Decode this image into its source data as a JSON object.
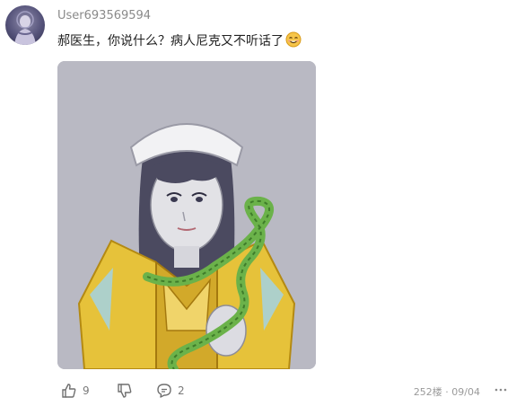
{
  "user": {
    "name": "User693569594",
    "avatar_icon": "user-avatar"
  },
  "comment": {
    "text": "郝医生，你说什么？病人尼克又不听话了",
    "emoji_icon": "smiling-face-emoji"
  },
  "image": {
    "description_icon": "nurse-anime-illustration"
  },
  "actions": {
    "like_icon": "thumbs-up-icon",
    "like_count": "9",
    "dislike_icon": "thumbs-down-icon",
    "reply_icon": "comment-bubble-icon",
    "reply_count": "2"
  },
  "meta": {
    "floor_date": "252楼 · 09/04",
    "more_icon": "more-dots-icon"
  },
  "colors": {
    "accent": "#7a7a7a",
    "image_bg": "#b8b8c2",
    "armor_gold": "#e6c23a",
    "leaf_green": "#6bb24a"
  }
}
